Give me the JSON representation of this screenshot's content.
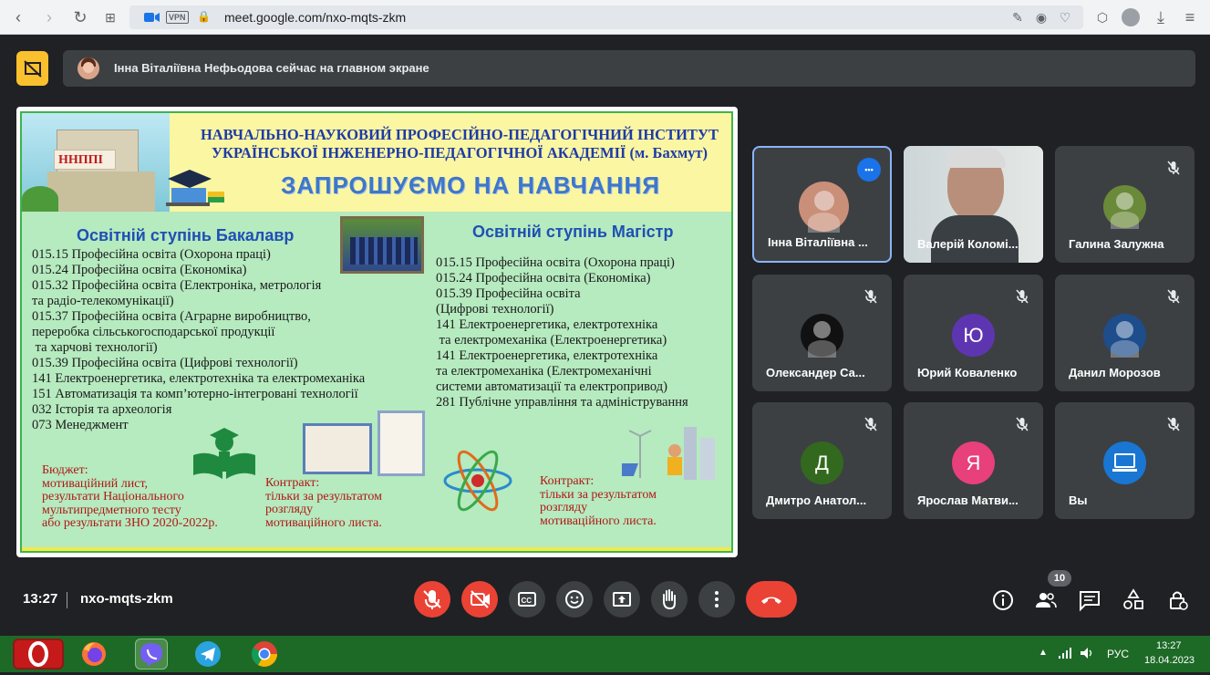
{
  "browser": {
    "url": "meet.google.com/nxo-mqts-zkm",
    "vpn_label": "VPN"
  },
  "banner": {
    "text": "Інна Віталіївна Нефьодова сейчас на главном экране"
  },
  "slide": {
    "header_line1": "НАВЧАЛЬНО-НАУКОВИЙ ПРОФЕСІЙНО-ПЕДАГОГІЧНИЙ ІНСТИТУТ",
    "header_line2": "УКРАЇНСЬКОЇ ІНЖЕНЕРНО-ПЕДАГОГІЧНОЇ АКАДЕМІЇ (м. Бахмут)",
    "logo_text": "ННППІ",
    "invite": "ЗАПРОШУЄМО НА НАВЧАННЯ",
    "bachelor_title": "Освітній ступінь Бакалавр",
    "bachelor_items": "015.15 Професійна освіта (Охорона праці)\n015.24 Професійна освіта (Економіка)\n015.32 Професійна освіта (Електроніка, метрологія\nта радіо-телекомунікації)\n015.37 Професійна освіта (Аграрне виробництво,\nпереробка сільськогосподарської продукції\n та харчові технології)\n015.39 Професійна освіта (Цифрові технології)\n141 Електроенергетика, електротехніка та електромеханіка\n151 Автоматизація та комп’ютерно-інтегровані технології\n032 Історія та археологія\n073 Менеджмент",
    "master_title": "Освітній ступінь Магістр",
    "master_items": "015.15 Професійна освіта (Охорона праці)\n015.24 Професійна освіта (Економіка)\n015.39 Професійна освіта\n(Цифрові технології)\n141 Електроенергетика, електротехніка\n та електромеханіка (Електроенергетика)\n141 Електроенергетика, електротехніка\nта електромеханіка (Електромеханічні\nсистеми автоматизації та електропривод)\n281 Публічне управління та адміністрування",
    "budget": "Бюджет:\nмотиваційний лист,\nрезультати Національного\nмультипредметного тесту\nабо результати ЗНО 2020-2022р.",
    "contract1": "Контракт:\nтільки за результатом\nрозгляду\nмотиваційного листа.",
    "contract2": "Контракт:\nтільки за результатом\nрозгляду\nмотиваційного листа."
  },
  "participants": [
    {
      "name": "Інна Віталіївна ...",
      "muted": false,
      "avatar": "photo",
      "avatar_color": "#c98f78"
    },
    {
      "name": "Валерій Коломі...",
      "muted": false,
      "avatar": "video",
      "avatar_color": "#b9c4c8"
    },
    {
      "name": "Галина Залужна",
      "muted": true,
      "avatar": "photo",
      "avatar_color": "#6a8a3a"
    },
    {
      "name": "Олександер Са...",
      "muted": true,
      "avatar": "photo",
      "avatar_color": "#111111"
    },
    {
      "name": "Юрий Коваленко",
      "muted": true,
      "avatar": "Ю",
      "avatar_color": "#5e35b1"
    },
    {
      "name": "Данил Морозов",
      "muted": true,
      "avatar": "photo",
      "avatar_color": "#1e4d8c"
    },
    {
      "name": "Дмитро Анатол...",
      "muted": true,
      "avatar": "Д",
      "avatar_color": "#33691e"
    },
    {
      "name": "Ярослав Матви...",
      "muted": true,
      "avatar": "Я",
      "avatar_color": "#e8407a"
    },
    {
      "name": "Вы",
      "muted": true,
      "avatar": "laptop",
      "avatar_color": "#1976d2"
    }
  ],
  "meeting": {
    "time": "13:27",
    "code": "nxo-mqts-zkm",
    "participant_count": "10"
  },
  "taskbar": {
    "lang": "РУС",
    "time": "13:27",
    "date": "18.04.2023"
  },
  "colors": {
    "end_call": "#ea4335",
    "accent": "#8ab4f8",
    "taskbar": "#1d6a27"
  }
}
